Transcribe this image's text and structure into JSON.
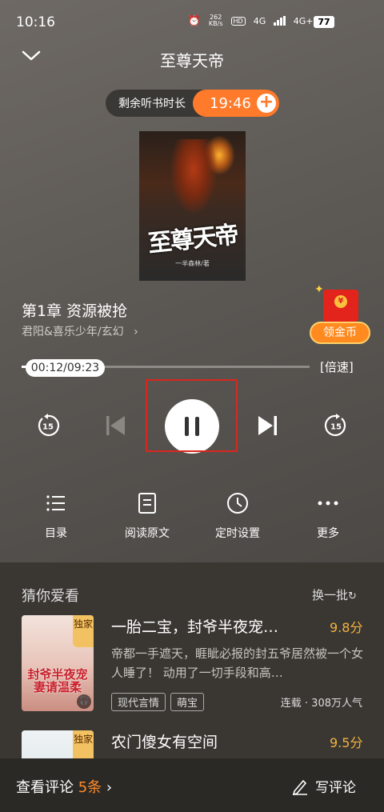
{
  "status_bar": {
    "time": "10:16",
    "net_speed_value": "262",
    "net_speed_unit": "KB/s",
    "hd_label": "HD",
    "signal_1": "4G",
    "signal_2": "4G+",
    "battery": "77"
  },
  "header": {
    "title": "至尊天帝"
  },
  "timer": {
    "label": "剩余听书时长",
    "value": "19:46",
    "plus_icon": "+"
  },
  "cover": {
    "title": "至尊天帝",
    "author": "一半森林/著"
  },
  "chapter": {
    "title": "第1章  资源被抢",
    "meta": "君阳&喜乐少年/玄幻",
    "chevron": "›"
  },
  "reward": {
    "label": "领金币",
    "coin_symbol": "¥"
  },
  "progress": {
    "time_text": "00:12/09:23",
    "fraction": 0.021,
    "speed_label": "[倍速]"
  },
  "controls": {
    "rewind_seconds": "15",
    "forward_seconds": "15"
  },
  "features": [
    {
      "label": "目录"
    },
    {
      "label": "阅读原文"
    },
    {
      "label": "定时设置"
    },
    {
      "label": "更多"
    }
  ],
  "recommendations": {
    "title": "猜你爱看",
    "refresh_label": "换一批",
    "books": [
      {
        "title": "一胎二宝，封爷半夜宠…",
        "score": "9.8分",
        "desc": "帝都一手遮天，睚眦必报的封五爷居然被一个女人睡了！ 动用了一切手段和高…",
        "tags": [
          "现代言情",
          "萌宝"
        ],
        "stat": "连载 · 308万人气",
        "badge": "独家",
        "cover_text": "封爷半夜宠妻请温柔"
      },
      {
        "title": "农门傻女有空间",
        "score": "9.5分",
        "badge": "独家"
      }
    ]
  },
  "bottom_bar": {
    "comments_label": "查看评论",
    "comments_count": "5条",
    "write_label": "写评论"
  }
}
